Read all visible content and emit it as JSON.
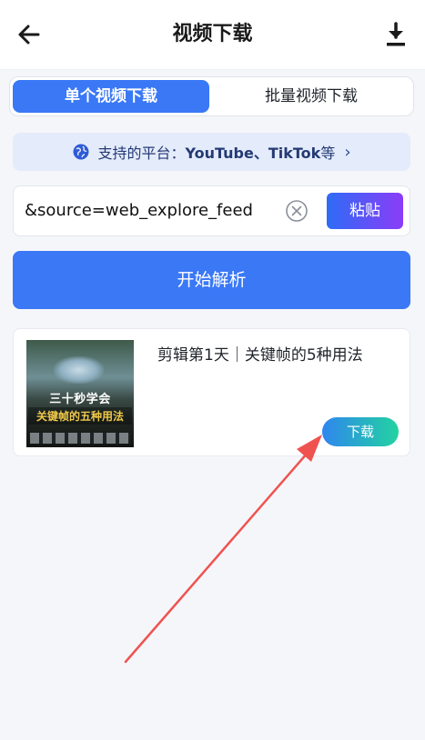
{
  "header": {
    "title": "视频下载",
    "back_icon": "arrow-left-icon",
    "download_icon": "download-icon"
  },
  "tabs": [
    {
      "label": "单个视频下载",
      "active": true
    },
    {
      "label": "批量视频下载",
      "active": false
    }
  ],
  "platform_banner": {
    "prefix": "支持的平台：",
    "platforms": "YouTube、TikTok",
    "suffix": " 等",
    "icon": "globe-icon"
  },
  "url_input": {
    "value": "&source=web_explore_feed"
  },
  "paste_button": {
    "label": "粘贴"
  },
  "parse_button": {
    "label": "开始解析"
  },
  "result": {
    "title": "剪辑第1天｜关键帧的5种用法",
    "thumbnail_line1": "三十秒学会",
    "thumbnail_line2": "关键帧的五种用法",
    "download_label": "下载"
  },
  "colors": {
    "primary": "#3a78f6",
    "paste_gradient": [
      "#2e6cf6",
      "#8b3cf7"
    ],
    "download_gradient": [
      "#2f86ee",
      "#22d3a0"
    ],
    "annotation_arrow": "#ef5350"
  }
}
